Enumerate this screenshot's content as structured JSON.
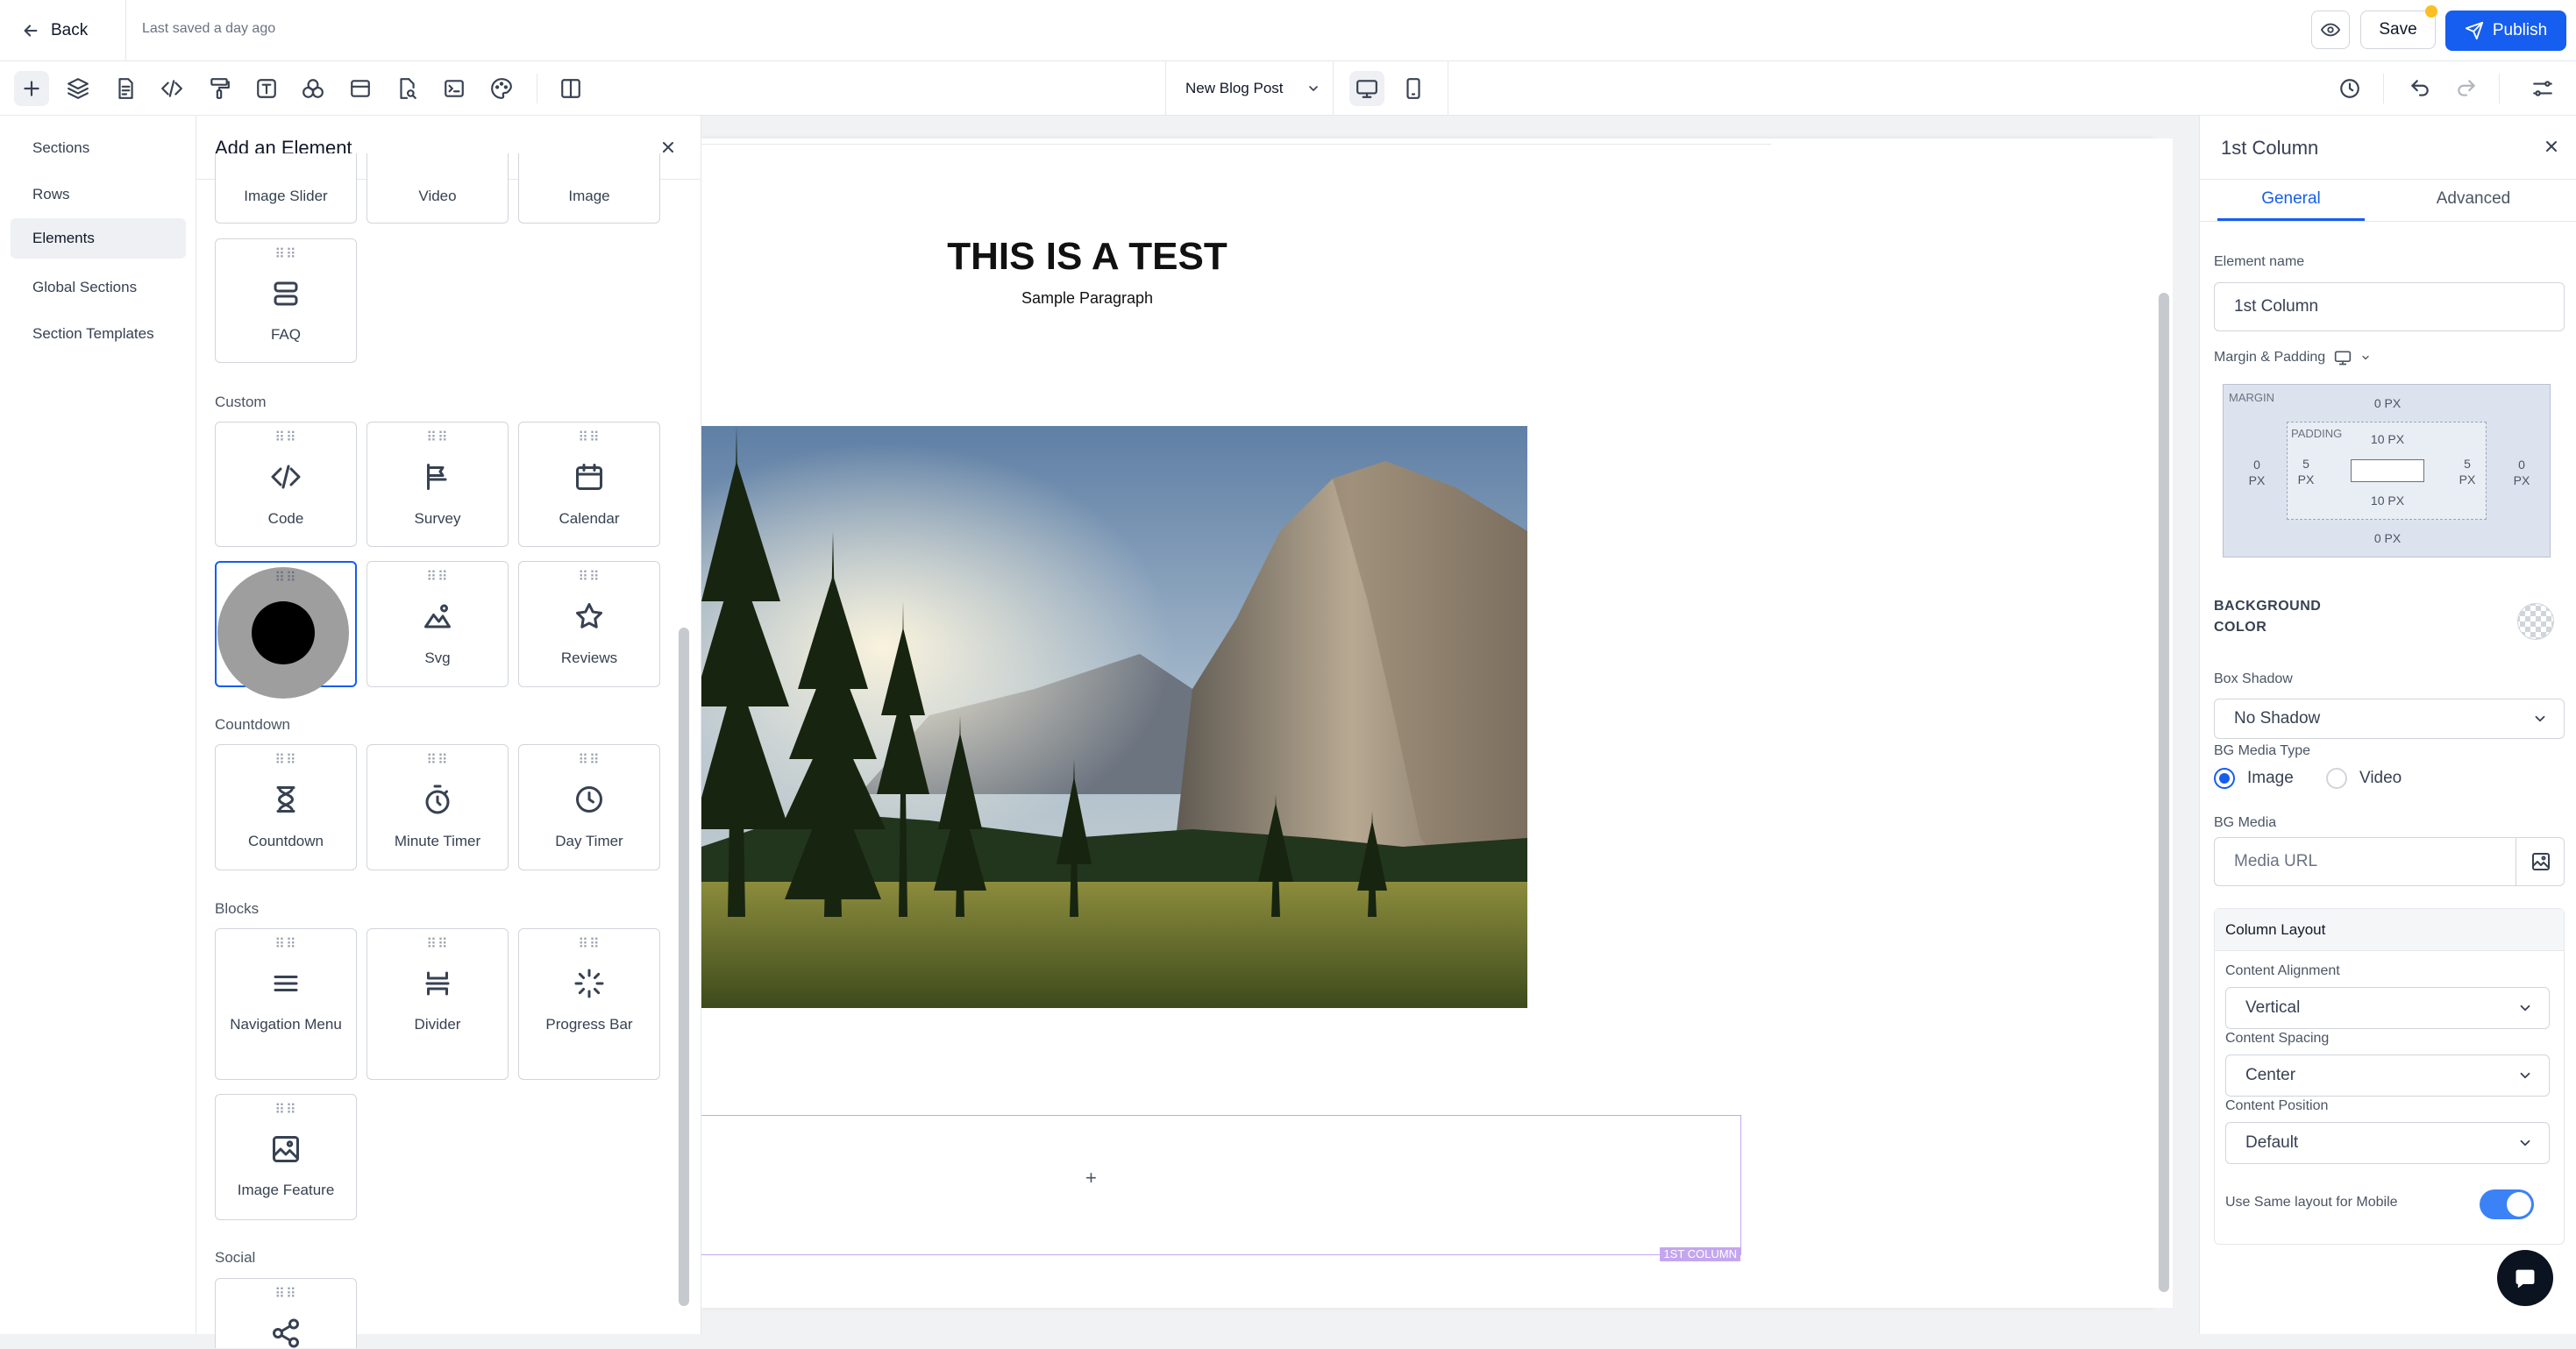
{
  "header": {
    "back_label": "Back",
    "saved_status": "Last saved a day ago",
    "save_label": "Save",
    "publish_label": "Publish"
  },
  "toolbar": {
    "page_selector": "New Blog Post",
    "icons": [
      "plus-icon",
      "layers-icon",
      "document-icon",
      "code-icon",
      "paint-roller-icon",
      "text-icon",
      "shapes-icon",
      "layout-icon",
      "search-page-icon",
      "terminal-icon",
      "palette-icon",
      "split-view-icon"
    ]
  },
  "left_nav": {
    "items": [
      {
        "label": "Sections"
      },
      {
        "label": "Rows"
      },
      {
        "label": "Elements"
      },
      {
        "label": "Global Sections"
      },
      {
        "label": "Section Templates"
      }
    ]
  },
  "element_panel": {
    "title": "Add an Element",
    "top_row": [
      "Image Slider",
      "Video",
      "Image"
    ],
    "faq": "FAQ",
    "groups": {
      "custom": {
        "title": "Custom",
        "items": [
          "Code",
          "Survey",
          "Calendar",
          "",
          "Svg",
          "Reviews"
        ]
      },
      "countdown": {
        "title": "Countdown",
        "items": [
          "Countdown",
          "Minute Timer",
          "Day Timer"
        ]
      },
      "blocks": {
        "title": "Blocks",
        "items": [
          "Navigation Menu",
          "Divider",
          "Progress Bar",
          "Image Feature"
        ]
      },
      "social": {
        "title": "Social"
      }
    }
  },
  "canvas": {
    "heading": "THIS IS A TEST",
    "paragraph": "Sample Paragraph",
    "column_tag": "1ST COLUMN",
    "add_symbol": "+"
  },
  "right_panel": {
    "title": "1st Column",
    "tabs": [
      "General",
      "Advanced"
    ],
    "element_name_label": "Element name",
    "element_name_value": "1st Column",
    "margin_padding_label": "Margin & Padding",
    "margin_label": "MARGIN",
    "padding_label": "PADDING",
    "margin": {
      "top": "0",
      "right": "0",
      "bottom": "0",
      "left": "0",
      "unit": "PX"
    },
    "padding": {
      "top": "10",
      "right": "5",
      "bottom": "10",
      "left": "5",
      "unit": "PX"
    },
    "bg_color_label": "BACKGROUND COLOR",
    "box_shadow_label": "Box Shadow",
    "box_shadow_value": "No Shadow",
    "bg_media_type_label": "BG Media Type",
    "media_types": [
      "Image",
      "Video"
    ],
    "selected_media_type": "Image",
    "bg_media_label": "BG Media",
    "media_url_placeholder": "Media URL",
    "column_layout_title": "Column Layout",
    "content_alignment_label": "Content Alignment",
    "content_alignment_value": "Vertical",
    "content_spacing_label": "Content Spacing",
    "content_spacing_value": "Center",
    "content_position_label": "Content Position",
    "content_position_value": "Default",
    "same_layout_label": "Use Same layout for Mobile",
    "same_layout_on": true
  },
  "colors": {
    "accent": "#155eef",
    "column_outline": "#c4a6f0",
    "badge": "#fbbf24"
  }
}
